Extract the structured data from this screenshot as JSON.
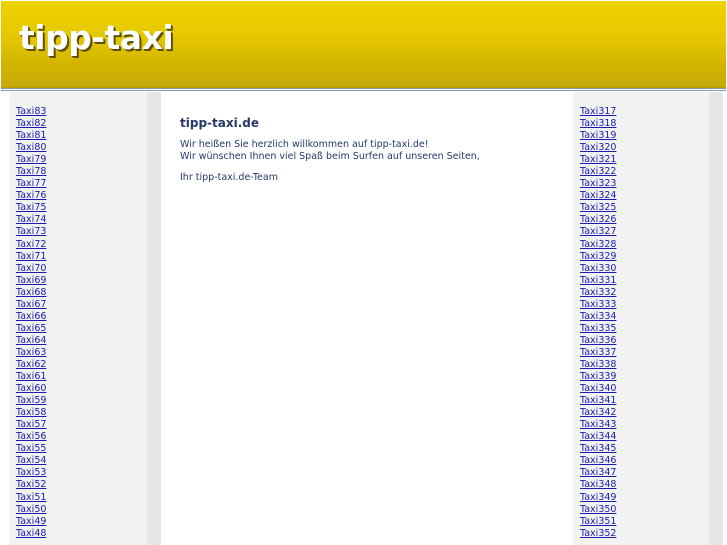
{
  "header": {
    "logo_text": "tipp-taxi"
  },
  "main": {
    "title": "tipp-taxi.de",
    "welcome_line1": "Wir heißen Sie herzlich willkommen auf tipp-taxi.de!",
    "welcome_line2": "Wir wünschen Ihnen viel Spaß beim Surfen auf unseren Seiten,",
    "signature": "Ihr tipp-taxi.de-Team"
  },
  "left_links": [
    "Taxi83",
    "Taxi82",
    "Taxi81",
    "Taxi80",
    "Taxi79",
    "Taxi78",
    "Taxi77",
    "Taxi76",
    "Taxi75",
    "Taxi74",
    "Taxi73",
    "Taxi72",
    "Taxi71",
    "Taxi70",
    "Taxi69",
    "Taxi68",
    "Taxi67",
    "Taxi66",
    "Taxi65",
    "Taxi64",
    "Taxi63",
    "Taxi62",
    "Taxi61",
    "Taxi60",
    "Taxi59",
    "Taxi58",
    "Taxi57",
    "Taxi56",
    "Taxi55",
    "Taxi54",
    "Taxi53",
    "Taxi52",
    "Taxi51",
    "Taxi50",
    "Taxi49",
    "Taxi48"
  ],
  "right_links": [
    "Taxi317",
    "Taxi318",
    "Taxi319",
    "Taxi320",
    "Taxi321",
    "Taxi322",
    "Taxi323",
    "Taxi324",
    "Taxi325",
    "Taxi326",
    "Taxi327",
    "Taxi328",
    "Taxi329",
    "Taxi330",
    "Taxi331",
    "Taxi332",
    "Taxi333",
    "Taxi334",
    "Taxi335",
    "Taxi336",
    "Taxi337",
    "Taxi338",
    "Taxi339",
    "Taxi340",
    "Taxi341",
    "Taxi342",
    "Taxi343",
    "Taxi344",
    "Taxi345",
    "Taxi346",
    "Taxi347",
    "Taxi348",
    "Taxi349",
    "Taxi350",
    "Taxi351",
    "Taxi352"
  ],
  "colors": {
    "header_yellow": "#e6c800",
    "link_blue": "#1a1ab0",
    "text_navy": "#26386a",
    "sidebar_gray": "#f2f2f2"
  }
}
